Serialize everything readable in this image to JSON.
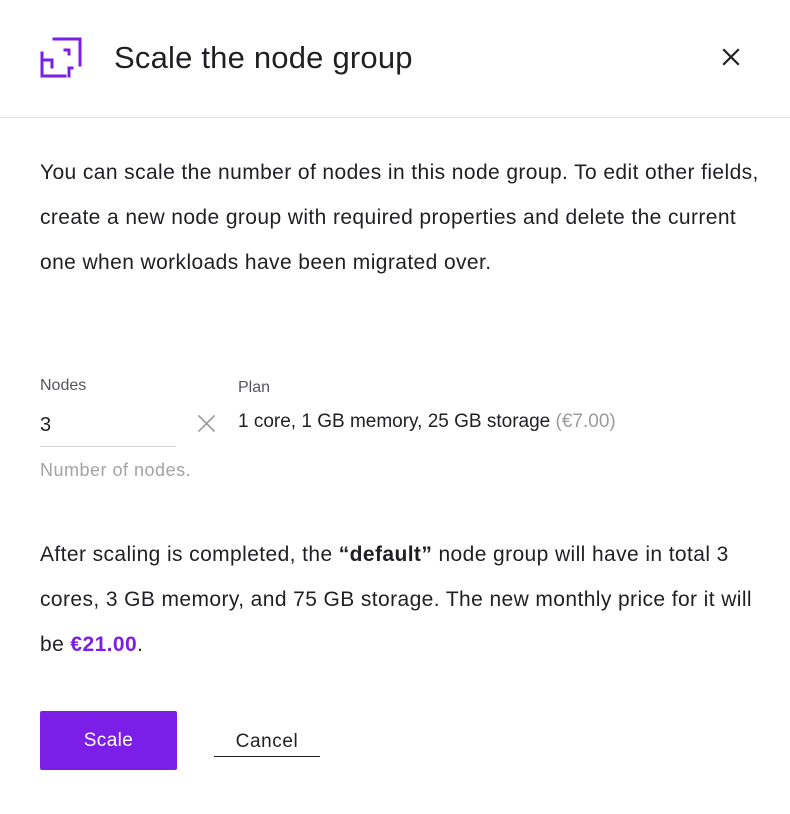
{
  "dialog": {
    "title": "Scale the node group",
    "header_icon": "scale-icon",
    "close_icon": "close-icon",
    "accent_color": "#7b1fe8"
  },
  "intro": {
    "text": "You can scale the number of nodes in this node group. To edit other fields, create a new node group with required properties and delete the current one when workloads have been migrated over."
  },
  "form": {
    "nodes_label": "Nodes",
    "nodes_value": "3",
    "nodes_helper": "Number of nodes.",
    "multiply_icon": "times-icon",
    "plan_label": "Plan",
    "plan_text": "1 core, 1 GB memory, 25 GB storage",
    "plan_price": "(€7.00)"
  },
  "summary": {
    "part1": "After scaling is completed, the ",
    "group_name": "“default”",
    "part2": " node group will have in total 3 cores, 3 GB memory, and 75 GB storage. The new monthly price for it will be ",
    "price": "€21.00",
    "part3": "."
  },
  "actions": {
    "scale_label": "Scale",
    "cancel_label": "Cancel"
  }
}
